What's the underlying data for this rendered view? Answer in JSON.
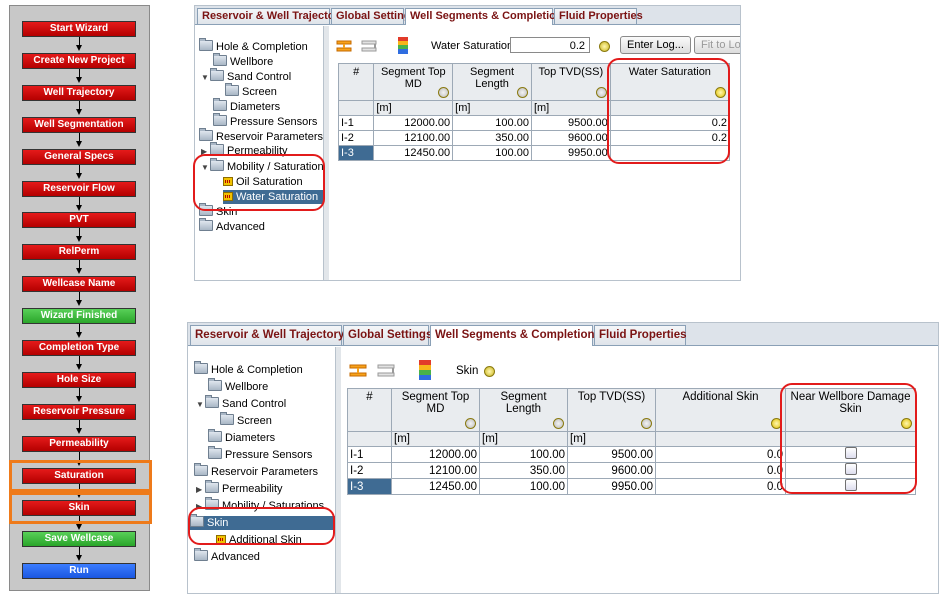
{
  "wizard": {
    "steps": [
      {
        "label": "Start Wizard",
        "color": "red"
      },
      {
        "label": "Create New Project",
        "color": "red"
      },
      {
        "label": "Well Trajectory",
        "color": "red"
      },
      {
        "label": "Well Segmentation",
        "color": "red"
      },
      {
        "label": "General Specs",
        "color": "red"
      },
      {
        "label": "Reservoir Flow",
        "color": "red"
      },
      {
        "label": "PVT",
        "color": "red"
      },
      {
        "label": "RelPerm",
        "color": "red"
      },
      {
        "label": "Wellcase Name",
        "color": "red"
      },
      {
        "label": "Wizard Finished",
        "color": "green"
      },
      {
        "label": "Completion Type",
        "color": "red"
      },
      {
        "label": "Hole Size",
        "color": "red"
      },
      {
        "label": "Reservoir Pressure",
        "color": "red"
      },
      {
        "label": "Permeability",
        "color": "red"
      },
      {
        "label": "Saturation",
        "color": "red"
      },
      {
        "label": "Skin",
        "color": "red"
      },
      {
        "label": "Save Wellcase",
        "color": "green"
      },
      {
        "label": "Run",
        "color": "blue"
      }
    ],
    "highlighted": [
      "Saturation",
      "Skin"
    ],
    "highlight_color": "#ee7a1a"
  },
  "tabs": [
    "Reservoir & Well Trajectory",
    "Global Settings",
    "Well Segments & Completions",
    "Fluid Properties"
  ],
  "active_tab": "Well Segments & Completions",
  "panel1": {
    "tree": [
      "Hole & Completion",
      "Wellbore",
      "Sand Control",
      "Screen",
      "Diameters",
      "Pressure Sensors",
      "Reservoir Parameters",
      "Permeability",
      "Mobility / Saturations",
      "Oil Saturation",
      "Water Saturation",
      "Skin",
      "Advanced"
    ],
    "selected_node": "Water Saturation",
    "field_label": "Water Saturation",
    "field_value": "0.2",
    "enter_log": "Enter Log...",
    "fit_to_log": "Fit to Log",
    "columns": [
      "#",
      "Segment Top MD",
      "Segment Length",
      "Top TVD(SS)",
      "Water Saturation"
    ],
    "units": [
      "",
      "[m]",
      "[m]",
      "[m]",
      ""
    ],
    "rows": [
      [
        "I-1",
        "12000.00",
        "100.00",
        "9500.00",
        "0.2"
      ],
      [
        "I-2",
        "12100.00",
        "350.00",
        "9600.00",
        "0.2"
      ],
      [
        "I-3",
        "12450.00",
        "100.00",
        "9950.00",
        "0.2"
      ]
    ]
  },
  "panel2": {
    "tree": [
      "Hole & Completion",
      "Wellbore",
      "Sand Control",
      "Screen",
      "Diameters",
      "Pressure Sensors",
      "Reservoir Parameters",
      "Permeability",
      "Mobility / Saturations",
      "Skin",
      "Additional Skin",
      "Advanced"
    ],
    "selected_node": "Skin",
    "field_label": "Skin",
    "columns": [
      "#",
      "Segment Top MD",
      "Segment Length",
      "Top TVD(SS)",
      "Additional Skin",
      "Near Wellbore Damage Skin"
    ],
    "units": [
      "",
      "[m]",
      "[m]",
      "[m]",
      "",
      ""
    ],
    "rows": [
      [
        "I-1",
        "12000.00",
        "100.00",
        "9500.00",
        "0.0"
      ],
      [
        "I-2",
        "12100.00",
        "350.00",
        "9600.00",
        "0.0"
      ],
      [
        "I-3",
        "12450.00",
        "100.00",
        "9950.00",
        "0.0"
      ]
    ]
  },
  "colors": {
    "highlight_red": "#e21b1b",
    "selection_blue": "#3f6b93",
    "tab_text": "#7a1313"
  }
}
